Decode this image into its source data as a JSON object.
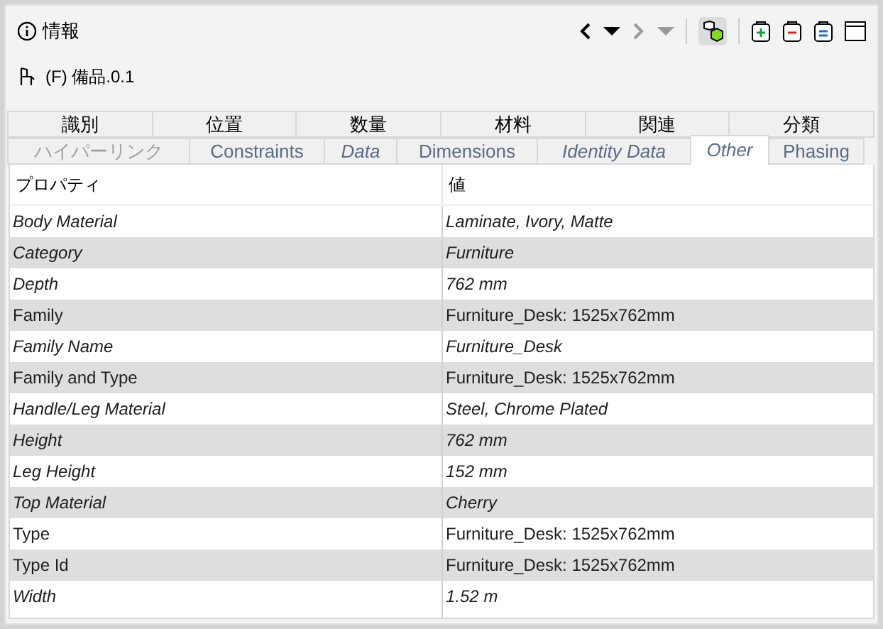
{
  "panel": {
    "title": "情報",
    "element": "(F) 備品.0.1"
  },
  "toolbar": {
    "back_disabled": false,
    "forward_disabled": true,
    "filter_selected": true
  },
  "tab_rows": [
    [
      {
        "label": "識別",
        "selected": false,
        "italic": false,
        "disabled": false
      },
      {
        "label": "位置",
        "selected": false,
        "italic": false,
        "disabled": false
      },
      {
        "label": "数量",
        "selected": false,
        "italic": false,
        "disabled": false
      },
      {
        "label": "材料",
        "selected": false,
        "italic": false,
        "disabled": false
      },
      {
        "label": "関連",
        "selected": false,
        "italic": false,
        "disabled": false
      },
      {
        "label": "分類",
        "selected": false,
        "italic": false,
        "disabled": false
      }
    ],
    [
      {
        "label": "ハイパーリンク",
        "selected": false,
        "italic": false,
        "disabled": true
      },
      {
        "label": "Constraints",
        "selected": false,
        "italic": false,
        "disabled": false
      },
      {
        "label": "Data",
        "selected": false,
        "italic": true,
        "disabled": false
      },
      {
        "label": "Dimensions",
        "selected": false,
        "italic": false,
        "disabled": false
      },
      {
        "label": "Identity Data",
        "selected": false,
        "italic": true,
        "disabled": false
      },
      {
        "label": "Other",
        "selected": true,
        "italic": true,
        "disabled": false
      },
      {
        "label": "Phasing",
        "selected": false,
        "italic": false,
        "disabled": false
      }
    ]
  ],
  "table": {
    "columns": [
      "プロパティ",
      "値"
    ],
    "rows": [
      {
        "property": "Body Material",
        "value": "Laminate, Ivory, Matte",
        "italic": true
      },
      {
        "property": "Category",
        "value": "Furniture",
        "italic": true
      },
      {
        "property": "Depth",
        "value": "762 mm",
        "italic": true
      },
      {
        "property": "Family",
        "value": "Furniture_Desk: 1525x762mm",
        "italic": false
      },
      {
        "property": "Family Name",
        "value": "Furniture_Desk",
        "italic": true
      },
      {
        "property": "Family and Type",
        "value": "Furniture_Desk: 1525x762mm",
        "italic": false
      },
      {
        "property": "Handle/Leg Material",
        "value": "Steel, Chrome Plated",
        "italic": true
      },
      {
        "property": "Height",
        "value": "762 mm",
        "italic": true
      },
      {
        "property": "Leg Height",
        "value": "152 mm",
        "italic": true
      },
      {
        "property": "Top Material",
        "value": "Cherry",
        "italic": true
      },
      {
        "property": "Type",
        "value": "Furniture_Desk: 1525x762mm",
        "italic": false
      },
      {
        "property": "Type Id",
        "value": "Furniture_Desk: 1525x762mm",
        "italic": false
      },
      {
        "property": "Width",
        "value": "1.52 m",
        "italic": true
      }
    ]
  }
}
